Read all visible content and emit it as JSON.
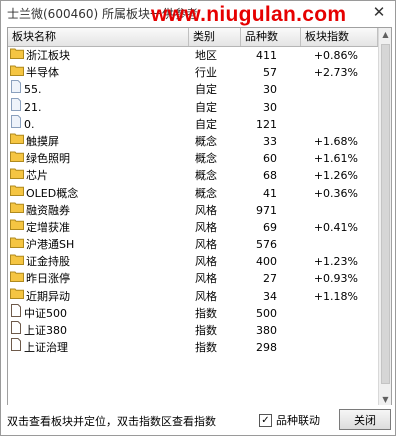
{
  "window": {
    "title": "士兰微(600460)  所属板块一供参考"
  },
  "watermark": "www.niugulan.com",
  "table": {
    "headers": [
      "板块名称",
      "类别",
      "品种数",
      "板块指数"
    ],
    "rows": [
      {
        "icon": "folder-icon",
        "name": "浙江板块",
        "category": "地区",
        "count": "411",
        "index": "+0.86%"
      },
      {
        "icon": "folder-icon",
        "name": "半导体",
        "category": "行业",
        "count": "57",
        "index": "+2.73%"
      },
      {
        "icon": "page-icon",
        "name": "55.",
        "category": "自定",
        "count": "30",
        "index": ""
      },
      {
        "icon": "page-icon",
        "name": "21.",
        "category": "自定",
        "count": "30",
        "index": ""
      },
      {
        "icon": "page-icon",
        "name": "0.",
        "category": "自定",
        "count": "121",
        "index": ""
      },
      {
        "icon": "folder-icon",
        "name": "触摸屏",
        "category": "概念",
        "count": "33",
        "index": "+1.68%"
      },
      {
        "icon": "folder-icon",
        "name": "绿色照明",
        "category": "概念",
        "count": "60",
        "index": "+1.61%"
      },
      {
        "icon": "folder-icon",
        "name": "芯片",
        "category": "概念",
        "count": "68",
        "index": "+1.26%"
      },
      {
        "icon": "folder-icon",
        "name": "OLED概念",
        "category": "概念",
        "count": "41",
        "index": "+0.36%"
      },
      {
        "icon": "folder-icon",
        "name": "融资融券",
        "category": "风格",
        "count": "971",
        "index": ""
      },
      {
        "icon": "folder-icon",
        "name": "定增获准",
        "category": "风格",
        "count": "69",
        "index": "+0.41%"
      },
      {
        "icon": "folder-icon",
        "name": "沪港通SH",
        "category": "风格",
        "count": "576",
        "index": ""
      },
      {
        "icon": "folder-icon",
        "name": "证金持股",
        "category": "风格",
        "count": "400",
        "index": "+1.23%"
      },
      {
        "icon": "folder-icon",
        "name": "昨日涨停",
        "category": "风格",
        "count": "27",
        "index": "+0.93%"
      },
      {
        "icon": "folder-icon",
        "name": "近期异动",
        "category": "风格",
        "count": "34",
        "index": "+1.18%"
      },
      {
        "icon": "doc-icon",
        "name": "中证500",
        "category": "指数",
        "count": "500",
        "index": ""
      },
      {
        "icon": "doc-icon",
        "name": "上证380",
        "category": "指数",
        "count": "380",
        "index": ""
      },
      {
        "icon": "doc-icon",
        "name": "上证治理",
        "category": "指数",
        "count": "298",
        "index": ""
      }
    ]
  },
  "statusbar": {
    "hint": "双击查看板块并定位，双击指数区查看指数",
    "checkbox_label": "品种联动",
    "checkbox_checked": true,
    "close_label": "关闭"
  },
  "colors": {
    "folder": "#f5c542",
    "watermark": "#e60000"
  }
}
